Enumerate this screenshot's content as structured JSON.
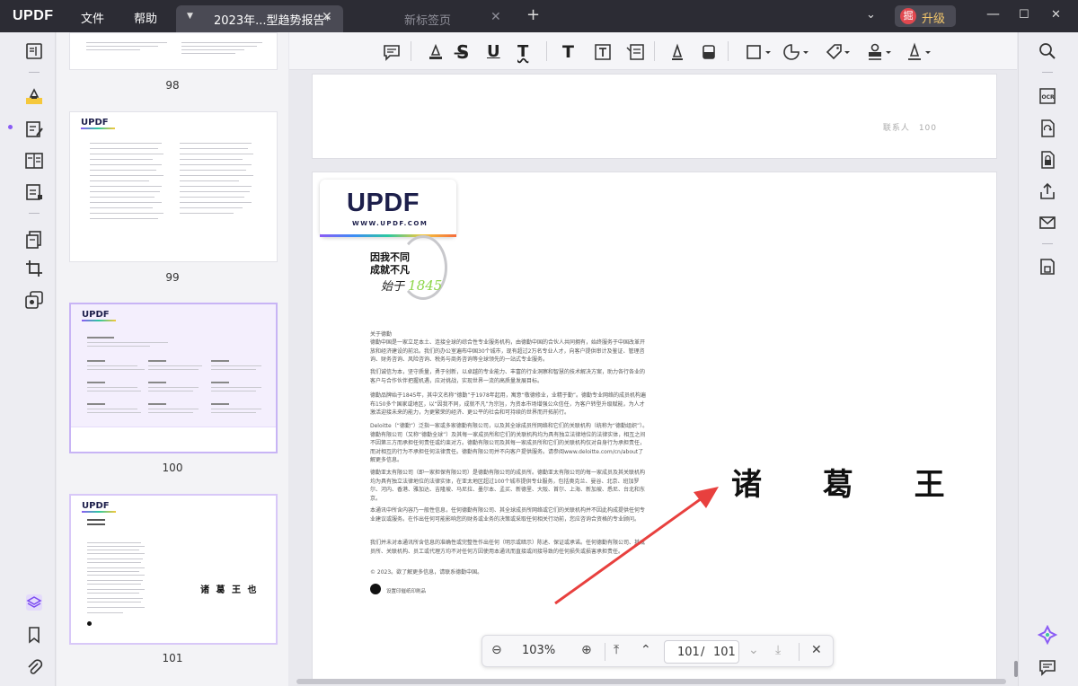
{
  "app": {
    "logo": "UPDF",
    "menu": [
      "文件",
      "帮助"
    ],
    "tabs": [
      {
        "label": "2023年...型趋势报告*",
        "active": true
      },
      {
        "label": "新标签页",
        "active": false
      }
    ],
    "upgrade_badge": "掘",
    "upgrade_label": "升级"
  },
  "thumbnails": {
    "pages": [
      "98",
      "99",
      "100",
      "101"
    ],
    "selected": "100",
    "thumb101_stamp": "诸 葛 王 也"
  },
  "document": {
    "top_page_footer": "联系人　100",
    "logo_text": "UPDF",
    "logo_url": "WWW.UPDF.COM",
    "slogan_line1": "因我不同",
    "slogan_line2": "成就不凡",
    "signature_text": "始于",
    "signature_num": "1845",
    "body_paragraphs": [
      "关于德勤",
      "德勤中国是一家立足本土、连接全球的综合性专业服务机构，由德勤中国的合伙人共同拥有，始终服务于中国改革开放和经济建设的前沿。我们的办公室遍布中国30个城市，现有超过2万名专业人才，向客户提供审计及鉴证、管理咨询、财务咨询、风险咨询、税务与商务咨询等全球领先的一站式专业服务。",
      "我们诚信为本，坚守质量，勇于创新，以卓越的专业能力、丰富的行业洞察和智慧的技术解决方案，助力各行各业的客户与合作伙伴把握机遇，应对挑战，实现世界一流的高质量发展目标。",
      "德勤品牌始于1845年，其中文名称“德勤”于1978年起用，寓意“敬德修业，业精于勤”。德勤专业网络的成员机构遍布150多个国家或地区，以“因我不同，成就不凡”为宗旨，为资本市场增强公众信任，为客户转型升级赋能，为人才激活迎接未来的能力，为更繁荣的经济、更公平的社会和可持续的世界而开拓前行。",
      "Deloitte（“德勤”）泛指一家或多家德勤有限公司，以及其全球成员所网络和它们的关联机构（统称为“德勤组织”）。德勤有限公司（又称“德勤全球”）及其每一家成员所和它们的关联机构均为具有独立法律地位的法律实体，相互之间不因第三方而承担任何责任或约束对方。德勤有限公司及其每一家成员所和它们的关联机构仅对自身行为承担责任，而对相互的行为不承担任何法律责任。德勤有限公司并不向客户提供服务。请参阅www.deloitte.com/cn/about了解更多信息。",
      "德勤亚太有限公司（即一家担保有限公司）是德勤有限公司的成员所。德勤亚太有限公司的每一家成员及其关联机构均为具有独立法律地位的法律实体，在亚太地区超过100个城市提供专业服务，包括奥克兰、曼谷、北京、班加罗尔、河内、香港、雅加达、吉隆坡、马尼拉、墨尔本、孟买、新德里、大阪、首尔、上海、新加坡、悉尼、台北和东京。",
      "本通讯中所含内容乃一般性信息，任何德勤有限公司、其全球成员所网络或它们的关联机构并不因此构成提供任何专业建议或服务。在作出任何可能影响您的财务或业务的决策或采取任何相关行动前，您应咨询合资格的专业顾问。",
      "我们并未对本通讯所含信息的准确性或完整性作出任何（明示或暗示）陈述、保证或承诺。任何德勤有限公司、其成员所、关联机构、员工或代理方均不对任何方因使用本通讯而直接或间接导致的任何损失或损害承担责任。",
      "© 2023。欲了解更多信息，请联系德勤中国。"
    ],
    "footer_note": "设置印催纸印刷品",
    "stamp_text": "诸 葛 王 也"
  },
  "zoom": {
    "value": "103%",
    "current_page": "101",
    "separator": "/",
    "total_pages": "101"
  },
  "colors": {
    "titlebar": "#2c2c34",
    "accent": "#8a5cf5",
    "arrow": "#e8403e",
    "upgrade_text": "#f4c76b"
  }
}
